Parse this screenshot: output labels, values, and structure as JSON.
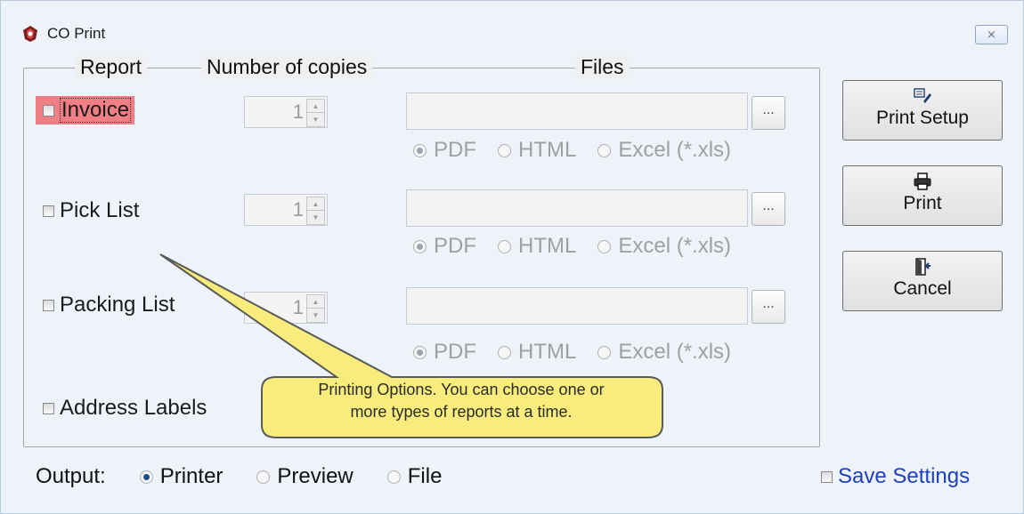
{
  "window": {
    "title": "CO Print",
    "close_glyph": "⨯"
  },
  "headers": {
    "report": "Report",
    "copies": "Number of copies",
    "files": "Files"
  },
  "reports": [
    {
      "label": "Invoice",
      "copies": "1",
      "formats": [
        "PDF",
        "HTML",
        "Excel (*.xls)"
      ],
      "selected_format": "PDF",
      "highlighted": true
    },
    {
      "label": "Pick List",
      "copies": "1",
      "formats": [
        "PDF",
        "HTML",
        "Excel (*.xls)"
      ],
      "selected_format": "PDF"
    },
    {
      "label": "Packing List",
      "copies": "1",
      "formats": [
        "PDF",
        "HTML",
        "Excel (*.xls)"
      ],
      "selected_format": "PDF"
    },
    {
      "label": "Address Labels"
    }
  ],
  "browse_label": "...",
  "buttons": {
    "print_setup": "Print Setup",
    "print": "Print",
    "cancel": "Cancel"
  },
  "output": {
    "label": "Output:",
    "options": [
      "Printer",
      "Preview",
      "File"
    ],
    "selected": "Printer"
  },
  "save_settings": "Save Settings",
  "callout": {
    "line1": "Printing Options. You can choose one or",
    "line2": "more types of reports at a time."
  },
  "colors": {
    "highlight": "#ef7f84",
    "callout_fill": "#f7ec7c",
    "link_blue": "#1f3fc4"
  },
  "icons": {
    "app": "app-logo-icon",
    "print_setup": "print-setup-icon",
    "print": "printer-icon",
    "cancel": "exit-door-icon"
  }
}
